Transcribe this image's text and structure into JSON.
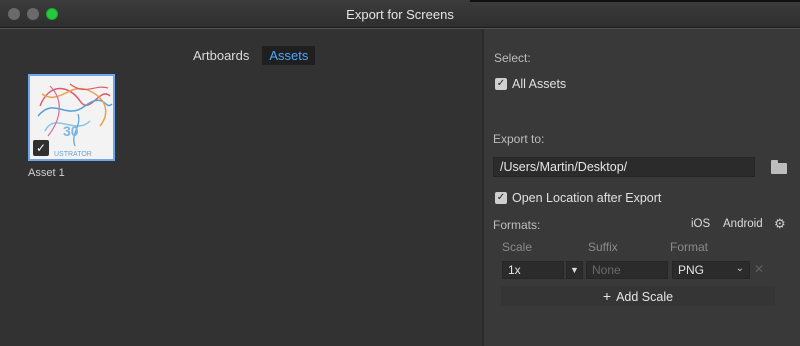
{
  "window": {
    "title": "Export for Screens"
  },
  "tabs": [
    {
      "label": "Artboards",
      "active": false
    },
    {
      "label": "Assets",
      "active": true
    }
  ],
  "assets": [
    {
      "name": "Asset 1",
      "selected": true,
      "thumbnail_text": "30",
      "thumbnail_caption": "USTRATOR"
    }
  ],
  "select": {
    "label": "Select:",
    "all_assets_label": "All Assets",
    "all_assets_checked": true
  },
  "export_to": {
    "label": "Export to:",
    "path": "/Users/Martin/Desktop/"
  },
  "open_location": {
    "label": "Open Location after Export",
    "checked": true
  },
  "formats": {
    "label": "Formats:",
    "presets": [
      "iOS",
      "Android"
    ],
    "columns": {
      "scale": "Scale",
      "suffix": "Suffix",
      "format": "Format"
    },
    "rows": [
      {
        "scale": "1x",
        "suffix_placeholder": "None",
        "format": "PNG"
      }
    ],
    "add_scale_label": "Add Scale"
  },
  "colors": {
    "accent": "#4ea7ff",
    "selection_border": "#6da7ee",
    "maximize": "#27c93f"
  }
}
